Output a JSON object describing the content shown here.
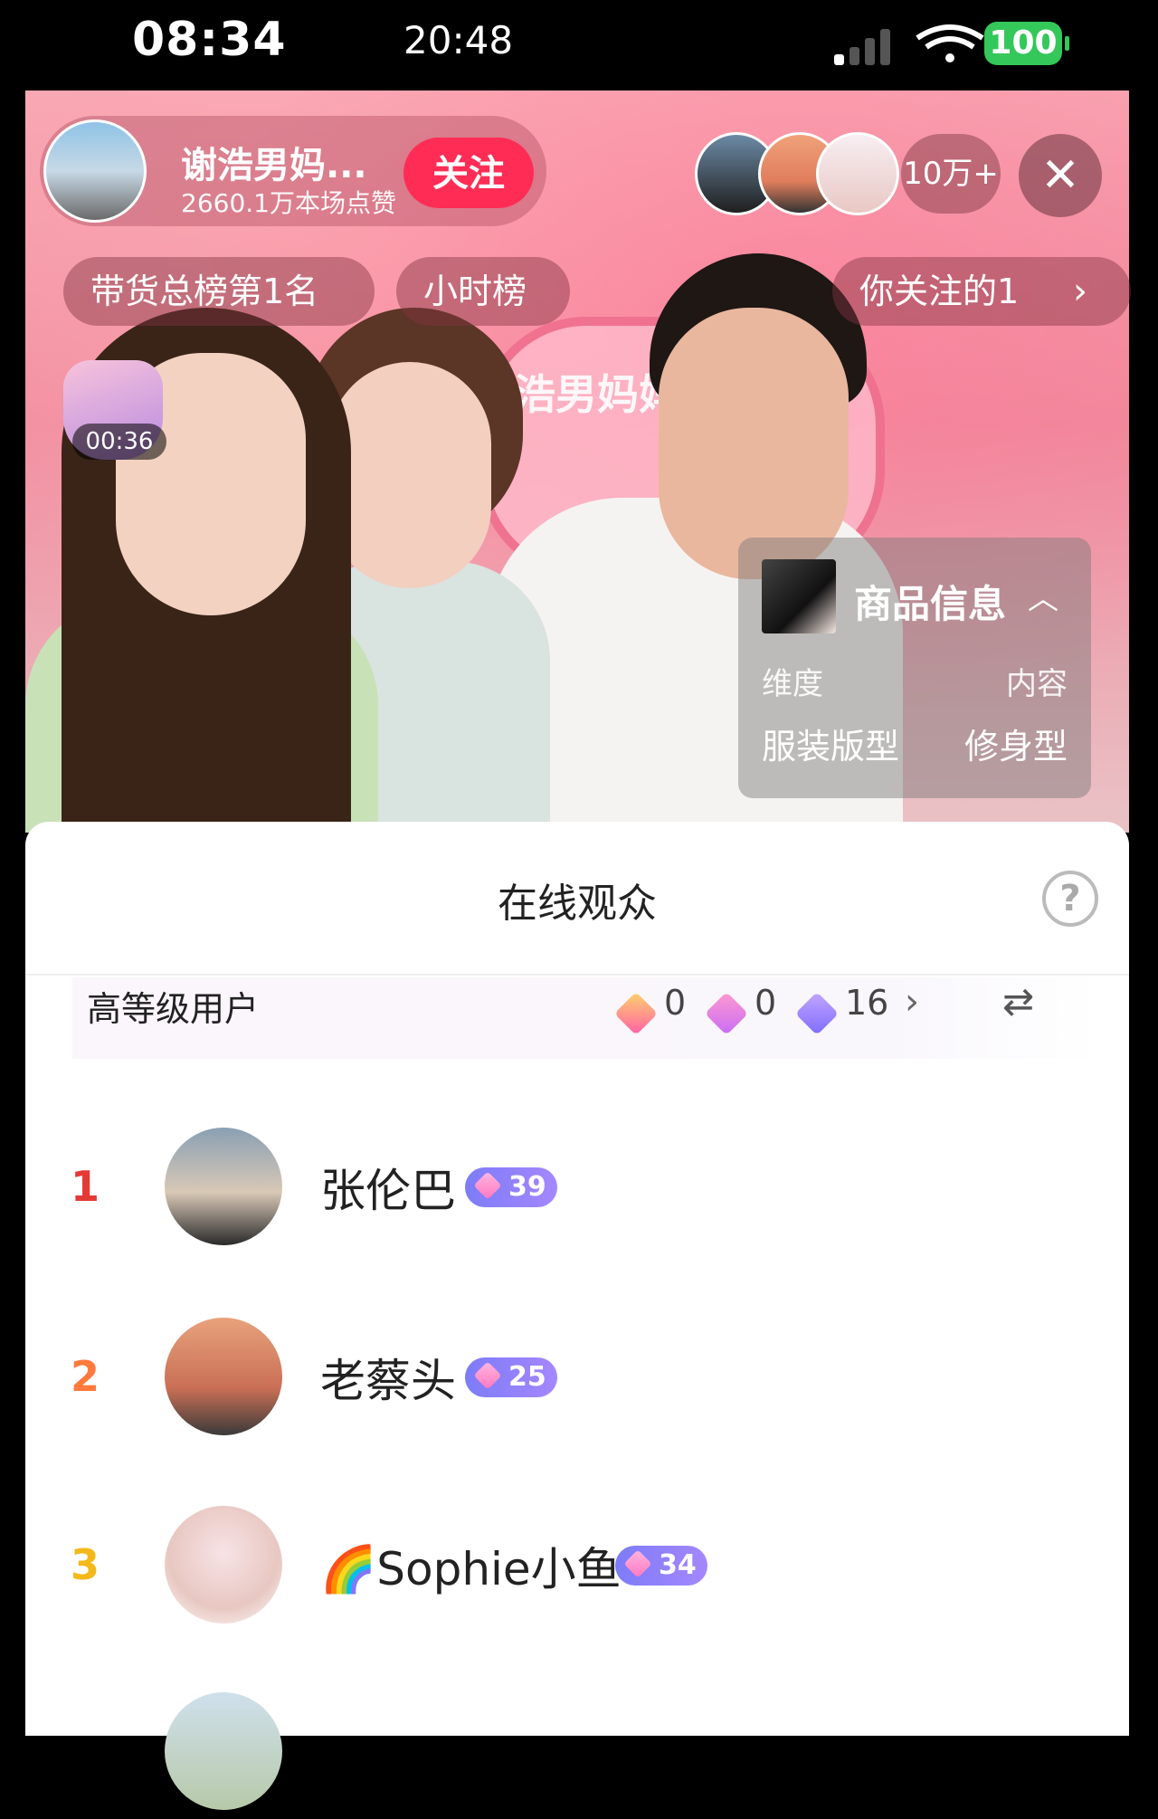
{
  "status_bar": {
    "time": "08:34",
    "time_secondary": "20:48",
    "battery": "100"
  },
  "stream": {
    "host_name": "谢浩男妈...",
    "host_likes": "2660.1万本场点赞",
    "follow_label": "关注",
    "viewer_count": "10万+",
    "close_icon": "close-icon",
    "background_sign": "浩男妈妈",
    "rank_pills": [
      "带货总榜第1名",
      "小时榜",
      "你关注的1"
    ],
    "timer": "00:36",
    "product_card": {
      "title": "商品信息",
      "header_left": "维度",
      "header_right": "内容",
      "value_left": "服装版型",
      "value_right": "修身型"
    }
  },
  "panel": {
    "title": "在线观众",
    "level_label": "高等级用户",
    "level_counts": [
      "0",
      "0",
      "16"
    ],
    "users": [
      {
        "rank": "1",
        "name": "张伦巴",
        "level": "39",
        "rank_color": "#e53935"
      },
      {
        "rank": "2",
        "name": "老蔡头",
        "level": "25",
        "rank_color": "#ff7a3c"
      },
      {
        "rank": "3",
        "name": "🌈Sophie小鱼",
        "level": "34",
        "rank_color": "#f5b81a"
      }
    ]
  },
  "colors": {
    "accent": "#ff2d55",
    "badge": "#8a7dff"
  }
}
